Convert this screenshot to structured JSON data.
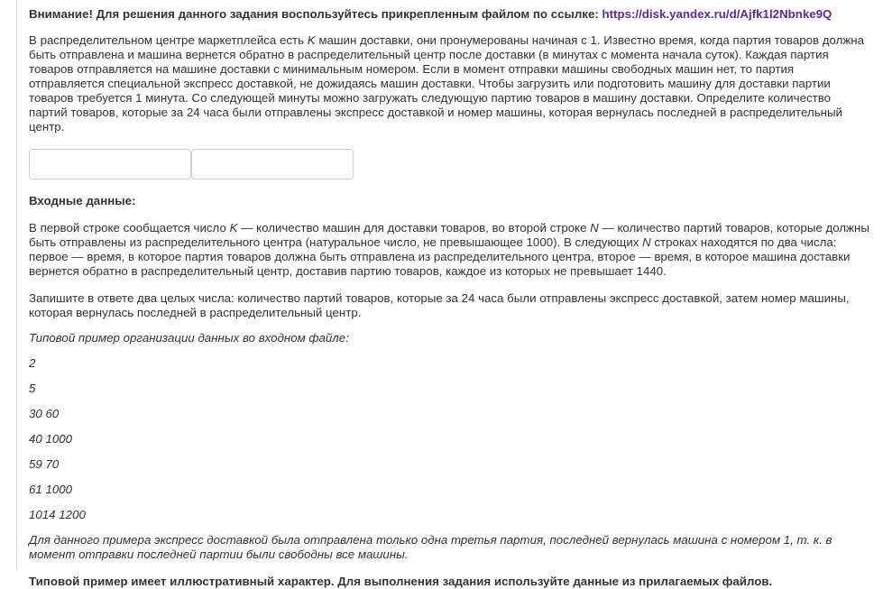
{
  "warning": {
    "prefix": "Внимание! Для решения данного задания воспользуйтесь прикрепленным файлом по ссылке: ",
    "link": "https://disk.yandex.ru/d/Ajfk1l2Nbnke9Q"
  },
  "problem": {
    "p1_a": "В распределительном центре маркетплейса есть ",
    "var_k": "K",
    "p1_b": " машин доставки, они пронумерованы начиная с 1. Известно время, когда партия товаров должна быть отправлена и машина вернется обратно в распределительный центр после доставки (в минутах с момента начала суток). Каждая партия товаров отправляется на машине доставки с минимальным номером. Если в момент отправки машины свободных машин нет, то партия отправляется специальной экспресс доставкой, не дожидаясь машин доставки. Чтобы загрузить или подготовить машину для доставки партии товаров требуется 1 минута. Со следующей минуты можно загружать следующую партию товаров в машину доставки. Определите количество партий товаров, которые за 24 часа были отправлены экспресс доставкой и номер машины, которая вернулась последней в распределительный центр."
  },
  "answer_fields": {
    "first_value": "",
    "second_value": ""
  },
  "input": {
    "heading": "Входные данные:",
    "p2_a": "В первой строке сообщается число ",
    "var_k": "K",
    "p2_b": " — количество машин для доставки товаров, во второй строке ",
    "var_n": "N",
    "p2_c": " — количество партий товаров, которые должны быть отправлены из распределительного центра (натуральное число, не превышающее 1000). В следующих ",
    "var_n2": "N",
    "p2_d": " строках находятся по два числа: первое — время, в которое партия товаров должна быть отправлена из распределительного центра, второе — время, в которое машина доставки вернется обратно в распределительный центр, доставив партию товаров, каждое из которых не превышает 1440.",
    "p3": "Запишите в ответе два целых числа: количество партий товаров, которые за 24 часа были отправлены экспресс доставкой, затем номер машины, которая вернулась последней в распределительный центр.",
    "example_title": "Типовой пример организации данных во входном файле:",
    "example_lines": [
      "2",
      "5",
      "30 60",
      "40 1000",
      "59 70",
      "61 1000",
      "1014 1200"
    ],
    "example_note": "Для данного примера экспресс доставкой была отправлена только одна третья партия, последней вернулась машина с номером 1, т. к. в момент отправки последней партии были свободны все машины.",
    "final_note": "Типовой пример имеет иллюстративный характер. Для выполнения задания используйте данные из прилагаемых файлов."
  }
}
